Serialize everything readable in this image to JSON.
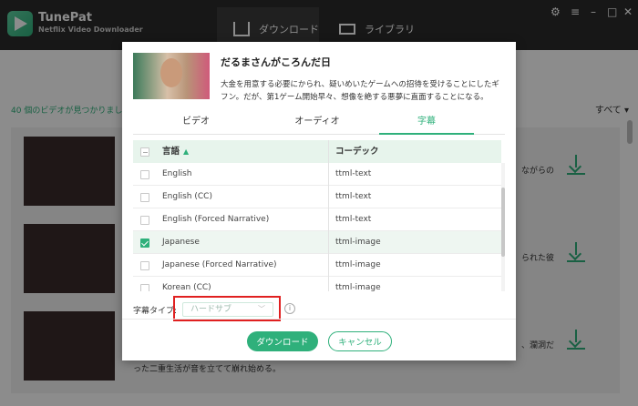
{
  "app": {
    "name": "TunePat",
    "subtitle": "Netflix Video Downloader",
    "nav": [
      {
        "label": "ダウンロード",
        "icon": "download-tray-icon"
      },
      {
        "label": "ライブラリ",
        "icon": "monitor-icon"
      }
    ],
    "window_controls": [
      "⚙",
      "≡",
      "–",
      "□",
      "✕"
    ],
    "list_header": "40 個のビデオが見つかりまし",
    "sort_label": "すべて ▾",
    "row_snippets": [
      "ながらの",
      "られた彼",
      "、瀾洞だ"
    ],
    "row_footer": "った二重生活が音を立てて崩れ始める。"
  },
  "dialog": {
    "title": "だるまさんがころんだ日",
    "description": "大金を用意する必要にかられ、疑いめいたゲームへの招待を受けることにしたギフン。だが、第1ゲーム開始早々、想像を絶する悪夢に直面することになる。",
    "tabs": [
      {
        "label": "ビデオ",
        "active": false
      },
      {
        "label": "オーディオ",
        "active": false
      },
      {
        "label": "字幕",
        "active": true
      }
    ],
    "table": {
      "columns": [
        "言語",
        "コーデック"
      ],
      "sort_indicator": "▲",
      "rows": [
        {
          "language": "English",
          "codec": "ttml-text",
          "checked": false
        },
        {
          "language": "English (CC)",
          "codec": "ttml-text",
          "checked": false
        },
        {
          "language": "English (Forced Narrative)",
          "codec": "ttml-text",
          "checked": false
        },
        {
          "language": "Japanese",
          "codec": "ttml-image",
          "checked": true
        },
        {
          "language": "Japanese (Forced Narrative)",
          "codec": "ttml-image",
          "checked": false
        },
        {
          "language": "Korean (CC)",
          "codec": "ttml-image",
          "checked": false
        }
      ]
    },
    "subtitle_type": {
      "label": "字幕タイプ:",
      "value": "ハードサブ",
      "info": "i"
    },
    "buttons": {
      "download": "ダウンロード",
      "cancel": "キャンセル"
    }
  }
}
